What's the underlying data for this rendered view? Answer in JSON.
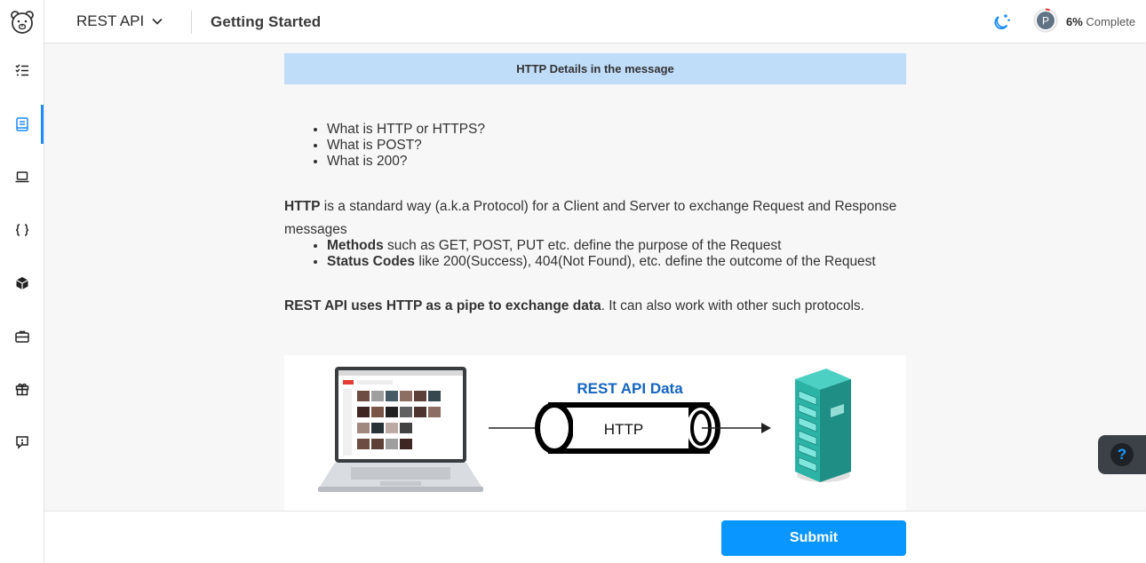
{
  "header": {
    "course_name": "REST API",
    "page_title": "Getting Started",
    "progress_percent": "6%",
    "progress_label": "Complete",
    "avatar_initial": "P"
  },
  "sidebar": {
    "items": [
      {
        "name": "checklist-icon",
        "active": false
      },
      {
        "name": "book-icon",
        "active": true
      },
      {
        "name": "laptop-icon",
        "active": false
      },
      {
        "name": "braces-icon",
        "active": false
      },
      {
        "name": "cube-icon",
        "active": false
      },
      {
        "name": "briefcase-icon",
        "active": false
      },
      {
        "name": "gift-icon",
        "active": false
      },
      {
        "name": "feedback-icon",
        "active": false
      }
    ]
  },
  "content": {
    "banner": "HTTP Details in the message",
    "questions": [
      "What is HTTP or HTTPS?",
      "What is POST?",
      "What is 200?"
    ],
    "http_term": "HTTP",
    "http_desc": " is a standard way (a.k.a Protocol) for a Client and Server to exchange Request and Response messages",
    "points": [
      {
        "term": "Methods",
        "text": " such as GET, POST, PUT etc. define the purpose of the Request"
      },
      {
        "term": "Status Codes",
        "text": " like 200(Success), 404(Not Found), etc. define the outcome of the Request"
      }
    ],
    "rest_bold": "REST API uses HTTP as a pipe to exchange data",
    "rest_text": ". It can also work with other such protocols.",
    "figure": {
      "title": "REST API Data",
      "pipe_label": "HTTP"
    }
  },
  "footer": {
    "submit_label": "Submit"
  },
  "help": {
    "label": "?"
  },
  "colors": {
    "accent": "#0a96ff",
    "banner": "#bfdcf9",
    "figure_title": "#1565c0",
    "server": "#26a69a"
  },
  "progress_value": 0.06
}
